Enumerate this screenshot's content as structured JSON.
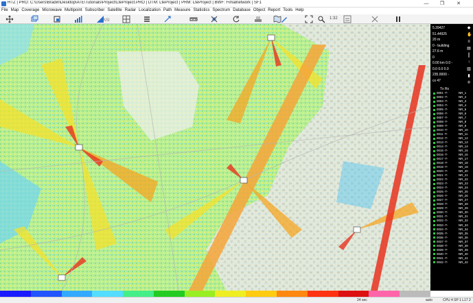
{
  "window": {
    "title": "HTZ | PRO: C:\\Users\\Bradin\\Desktop\\ATE\\Tutorials\\Project\\LteProject.PRO | DTM: LteProject | PRM: LteProject | BWF: Fimalnetwork | SF1",
    "minimize": "—",
    "maximize": "❐",
    "close": "✕"
  },
  "menu": [
    "File",
    "Map",
    "Coverage",
    "Microwave",
    "Multipoint",
    "Subscriber",
    "Satellite",
    "Radar",
    "Localization",
    "Path",
    "Measure",
    "Statistics",
    "Spectrum",
    "Database",
    "Object",
    "Report",
    "Tools",
    "Help"
  ],
  "toolbar": {
    "zoom": "1:32",
    "tools": [
      "move-icon",
      "layers-icon",
      "zoom-in-icon",
      "bar-chart-icon",
      "signal-icon",
      "antenna-icon",
      "grid-icon",
      "list-icon",
      "pan-icon",
      "ruler-icon",
      "crosshair-icon",
      "refresh-icon",
      "layers2-icon",
      "map-icon",
      "draw-icon",
      "expand-icon",
      "search-icon",
      "print-icon",
      "export-icon",
      "pause-icon"
    ]
  },
  "sidepanel": {
    "lines": [
      "5.39427",
      "51.44925",
      "20 m",
      "0 - building",
      "27.6 m",
      "0",
      "0.00 km  0.0 ◦",
      "0.0  0.0  0.0",
      "235.0000 ◦",
      "cx 47"
    ],
    "site_header": "Tx Rx",
    "sites": [
      {
        "id": "0001 -T-",
        "nr": "NR_1"
      },
      {
        "id": "0002 -T-",
        "nr": "NR_2"
      },
      {
        "id": "0003 -T-",
        "nr": "NR_3"
      },
      {
        "id": "0004 -T-",
        "nr": "NR_4"
      },
      {
        "id": "0005 -T-",
        "nr": "NR_5"
      },
      {
        "id": "0006 -T-",
        "nr": "NR_6"
      },
      {
        "id": "0007 -T-",
        "nr": "NR_7"
      },
      {
        "id": "0008 -T-",
        "nr": "NR_8"
      },
      {
        "id": "0009 -T-",
        "nr": "NR_9"
      },
      {
        "id": "0010 -T-",
        "nr": "NR_10"
      },
      {
        "id": "0011 -T-",
        "nr": "NR_11"
      },
      {
        "id": "0012 -T-",
        "nr": "NR_12"
      },
      {
        "id": "0013 -T-",
        "nr": "NR_13"
      },
      {
        "id": "0014 -T-",
        "nr": "NR_14"
      },
      {
        "id": "0015 -T-",
        "nr": "NR_15"
      },
      {
        "id": "0016 -T-",
        "nr": "NR_16"
      },
      {
        "id": "0017 -T-",
        "nr": "NR_17"
      },
      {
        "id": "0018 -T-",
        "nr": "NR_18"
      },
      {
        "id": "0019 -T-",
        "nr": "NR_19"
      },
      {
        "id": "0020 -T-",
        "nr": "NR_20"
      },
      {
        "id": "0021 -T-",
        "nr": "NR_21"
      },
      {
        "id": "0022 -T-",
        "nr": "NR_22"
      },
      {
        "id": "0023 -T-",
        "nr": "NR_23"
      },
      {
        "id": "0024 -T-",
        "nr": "NR_24"
      },
      {
        "id": "0025 -T-",
        "nr": "NR_25"
      },
      {
        "id": "0026 -T-",
        "nr": "NR_26"
      },
      {
        "id": "0027 -T-",
        "nr": "NR_27"
      },
      {
        "id": "0028 -T-",
        "nr": "NR_28"
      },
      {
        "id": "0029 -T-",
        "nr": "NR_29"
      },
      {
        "id": "0030 -T-",
        "nr": "NR_30"
      },
      {
        "id": "0031 -T-",
        "nr": "NR_31"
      },
      {
        "id": "0032 -T-",
        "nr": "NR_32"
      },
      {
        "id": "0033 -T-",
        "nr": "NR_33"
      },
      {
        "id": "0034 -T-",
        "nr": "NR_34"
      },
      {
        "id": "0035 -T-",
        "nr": "NR_35"
      },
      {
        "id": "0036 -T-",
        "nr": "NR_36"
      },
      {
        "id": "0037 -T-",
        "nr": "NR_37"
      },
      {
        "id": "0038 -T-",
        "nr": "NR_38"
      },
      {
        "id": "0039 -T-",
        "nr": "NR_39"
      },
      {
        "id": "0040 -T-",
        "nr": "NR_40"
      },
      {
        "id": "0041 -T-",
        "nr": "NR_41"
      },
      {
        "id": "0042 -T-",
        "nr": "NR_42"
      }
    ]
  },
  "legend_colors": [
    "#1a1aff",
    "#2255ff",
    "#33aaff",
    "#55ddff",
    "#44ee88",
    "#22cc22",
    "#99ee22",
    "#eeee22",
    "#ffcc11",
    "#ff8811",
    "#ff3311",
    "#dd1111",
    "#ff66aa",
    "#bbbbbb"
  ],
  "status": {
    "time": "24 sec",
    "mode": "auto",
    "cpu": "CPU 4  SP 1  L17 2"
  }
}
